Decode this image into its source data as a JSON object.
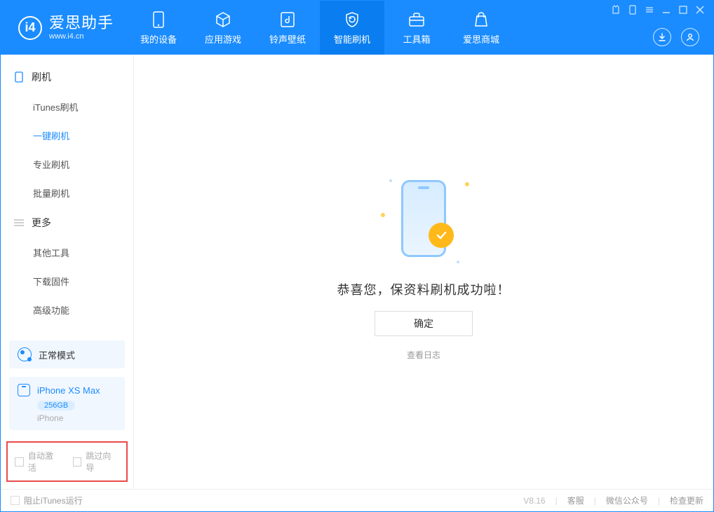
{
  "brand": {
    "title": "爱思助手",
    "subtitle": "www.i4.cn",
    "logo_text": "i4"
  },
  "nav": {
    "items": [
      {
        "label": "我的设备",
        "icon": "device"
      },
      {
        "label": "应用游戏",
        "icon": "cube"
      },
      {
        "label": "铃声壁纸",
        "icon": "music"
      },
      {
        "label": "智能刷机",
        "icon": "refresh"
      },
      {
        "label": "工具箱",
        "icon": "toolbox"
      },
      {
        "label": "爱思商城",
        "icon": "store"
      }
    ],
    "active_index": 3
  },
  "sidebar": {
    "groups": [
      {
        "label": "刷机",
        "icon": "phone"
      },
      {
        "label": "更多",
        "icon": "menu"
      }
    ],
    "items_flash": [
      {
        "label": "iTunes刷机"
      },
      {
        "label": "一键刷机"
      },
      {
        "label": "专业刷机"
      },
      {
        "label": "批量刷机"
      }
    ],
    "items_more": [
      {
        "label": "其他工具"
      },
      {
        "label": "下载固件"
      },
      {
        "label": "高级功能"
      }
    ],
    "active_flash_index": 1,
    "mode": {
      "label": "正常模式"
    },
    "device": {
      "name": "iPhone XS Max",
      "capacity": "256GB",
      "type": "iPhone"
    },
    "checkboxes": {
      "auto_activate": "自动激活",
      "skip_guide": "跳过向导"
    }
  },
  "main": {
    "success_text": "恭喜您，保资料刷机成功啦！",
    "ok_button": "确定",
    "log_link": "查看日志"
  },
  "footer": {
    "block_itunes": "阻止iTunes运行",
    "version": "V8.16",
    "links": [
      "客服",
      "微信公众号",
      "检查更新"
    ]
  }
}
